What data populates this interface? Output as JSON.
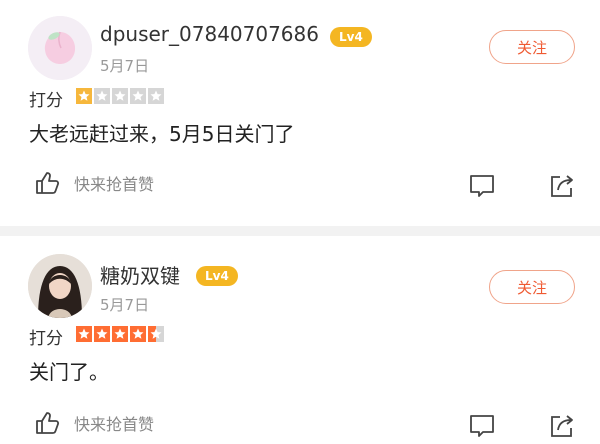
{
  "reviews": [
    {
      "username": "dpuser_07840707686",
      "level": "Lv4",
      "date": "5月7日",
      "follow_label": "关注",
      "rating_label": "打分",
      "rating": 1,
      "max_rating": 5,
      "comment": "大老远赶过来，5月5日关门了",
      "like_label": "快来抢首赞"
    },
    {
      "username": "糖奶双键",
      "level": "Lv4",
      "date": "5月7日",
      "follow_label": "关注",
      "rating_label": "打分",
      "rating": 4.5,
      "max_rating": 5,
      "comment": "关门了。",
      "like_label": "快来抢首赞"
    }
  ],
  "colors": {
    "accent": "#ef5a32",
    "level_badge": "#f4b622",
    "star_full": "#ff6d33",
    "star_empty": "#d6d6d6"
  }
}
